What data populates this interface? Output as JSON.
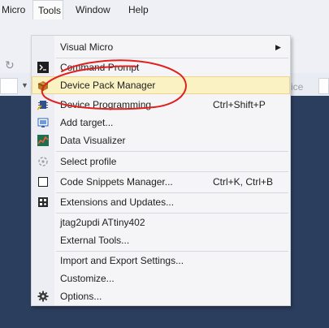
{
  "menubar": {
    "items": [
      {
        "label": "Micro",
        "active": false
      },
      {
        "label": "Tools",
        "active": true
      },
      {
        "label": "Window",
        "active": false
      },
      {
        "label": "Help",
        "active": false
      }
    ]
  },
  "toolbar": {
    "right_text": "vice"
  },
  "tools_menu": {
    "items": [
      {
        "label": "Visual Micro",
        "shortcut": "",
        "submenu": true,
        "icon": "none"
      },
      {
        "label": "Command Prompt",
        "shortcut": "",
        "icon": "terminal-icon"
      },
      {
        "label": "Device Pack Manager",
        "shortcut": "",
        "icon": "package-icon",
        "highlighted": true
      },
      {
        "label": "Device Programming",
        "shortcut": "Ctrl+Shift+P",
        "icon": "programming-icon"
      },
      {
        "label": "Add target...",
        "shortcut": "",
        "icon": "add-target-icon"
      },
      {
        "label": "Data Visualizer",
        "shortcut": "",
        "icon": "data-visualizer-icon"
      },
      {
        "label": "Select profile",
        "shortcut": "",
        "icon": "profile-icon"
      },
      {
        "label": "Code Snippets Manager...",
        "shortcut": "Ctrl+K, Ctrl+B",
        "icon": "snippet-checkbox-icon"
      },
      {
        "label": "Extensions and Updates...",
        "shortcut": "",
        "icon": "extensions-icon"
      },
      {
        "label": "jtag2updi ATtiny402",
        "shortcut": "",
        "icon": "none"
      },
      {
        "label": "External Tools...",
        "shortcut": "",
        "icon": "none"
      },
      {
        "label": "Import and Export Settings...",
        "shortcut": "",
        "icon": "none"
      },
      {
        "label": "Customize...",
        "shortcut": "",
        "icon": "none"
      },
      {
        "label": "Options...",
        "shortcut": "",
        "icon": "gear-icon"
      }
    ]
  },
  "colors": {
    "highlight": "#fbf2c4",
    "annotation": "#e0201e",
    "editor_background": "#2c3e5e"
  }
}
